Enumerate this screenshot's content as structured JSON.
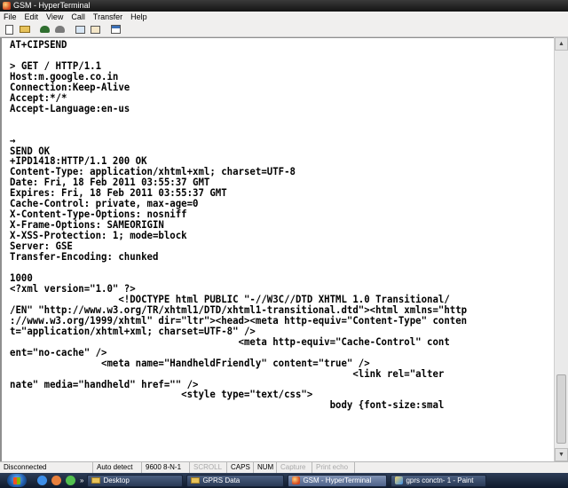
{
  "window": {
    "title": "GSM - HyperTerminal"
  },
  "menu": [
    "File",
    "Edit",
    "View",
    "Call",
    "Transfer",
    "Help"
  ],
  "toolbar": {
    "icons": [
      "new-file-icon",
      "open-folder-icon",
      "call-icon",
      "disconnect-icon",
      "send-icon",
      "receive-icon",
      "properties-icon"
    ]
  },
  "terminal": {
    "lines": [
      "AT+CIPSEND",
      "",
      "> GET / HTTP/1.1",
      "Host:m.google.co.in",
      "Connection:Keep-Alive",
      "Accept:*/*",
      "Accept-Language:en-us",
      "",
      "",
      "→",
      "SEND OK",
      "+IPD1418:HTTP/1.1 200 OK",
      "Content-Type: application/xhtml+xml; charset=UTF-8",
      "Date: Fri, 18 Feb 2011 03:55:37 GMT",
      "Expires: Fri, 18 Feb 2011 03:55:37 GMT",
      "Cache-Control: private, max-age=0",
      "X-Content-Type-Options: nosniff",
      "X-Frame-Options: SAMEORIGIN",
      "X-XSS-Protection: 1; mode=block",
      "Server: GSE",
      "Transfer-Encoding: chunked",
      "",
      "1000",
      "<?xml version=\"1.0\" ?>",
      "                   <!DOCTYPE html PUBLIC \"-//W3C//DTD XHTML 1.0 Transitional/",
      "/EN\" \"http://www.w3.org/TR/xhtml1/DTD/xhtml1-transitional.dtd\"><html xmlns=\"http",
      "://www.w3.org/1999/xhtml\" dir=\"ltr\"><head><meta http-equiv=\"Content-Type\" conten",
      "t=\"application/xhtml+xml; charset=UTF-8\" />",
      "                                        <meta http-equiv=\"Cache-Control\" cont",
      "ent=\"no-cache\" />",
      "                <meta name=\"HandheldFriendly\" content=\"true\" />",
      "                                                            <link rel=\"alter",
      "nate\" media=\"handheld\" href=\"\" />",
      "                              <style type=\"text/css\">",
      "                                                        body {font-size:smal"
    ]
  },
  "statusbar": {
    "connection": "Disconnected",
    "detect": "Auto detect",
    "port": "9600 8-N-1",
    "scroll": "SCROLL",
    "caps": "CAPS",
    "num": "NUM",
    "capture": "Capture",
    "print": "Print echo"
  },
  "taskbar": {
    "more": "»",
    "buttons": [
      {
        "label": "Desktop",
        "icon": "folder-icon"
      },
      {
        "label": "GPRS Data",
        "icon": "folder-icon"
      },
      {
        "label": "GSM - HyperTerminal",
        "icon": "hyperterminal-icon",
        "active": true
      },
      {
        "label": "gprs conctn- 1 - Paint",
        "icon": "paint-icon"
      }
    ]
  }
}
